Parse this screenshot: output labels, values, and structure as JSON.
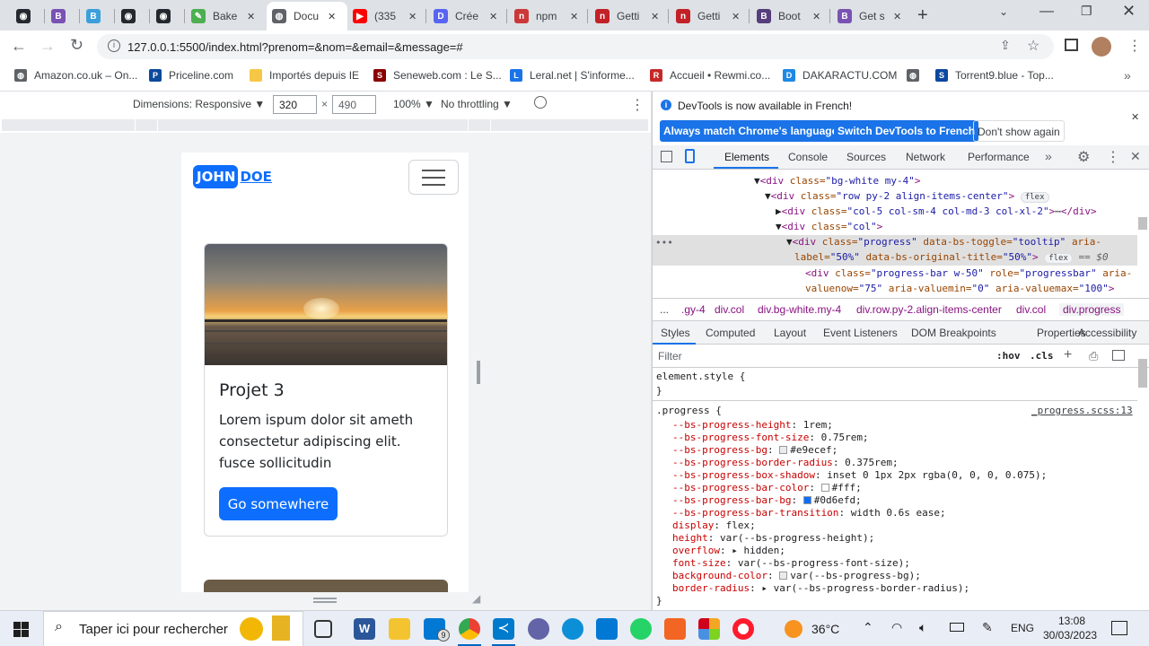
{
  "tabs": [
    {
      "title": "",
      "color": "#24292f",
      "glyph": "◉"
    },
    {
      "title": "",
      "color": "#7952b3",
      "glyph": "B"
    },
    {
      "title": "",
      "color": "#3c9fd9",
      "glyph": "B"
    },
    {
      "title": "",
      "color": "#24292f",
      "glyph": "◉"
    },
    {
      "title": "",
      "color": "#24292f",
      "glyph": "◉"
    },
    {
      "title": "Bake",
      "color": "#4caf50",
      "glyph": "✎"
    },
    {
      "title": "Docu",
      "color": "#5f6368",
      "glyph": "◍"
    },
    {
      "title": "(335",
      "color": "#ff0000",
      "glyph": "▶"
    },
    {
      "title": "Crée",
      "color": "#5865f2",
      "glyph": "D"
    },
    {
      "title": "npm",
      "color": "#cb3837",
      "glyph": "n"
    },
    {
      "title": "Getti",
      "color": "#c12127",
      "glyph": "n"
    },
    {
      "title": "Getti",
      "color": "#c12127",
      "glyph": "n"
    },
    {
      "title": "Boot",
      "color": "#563d7c",
      "glyph": "B"
    },
    {
      "title": "Get s",
      "color": "#7952b3",
      "glyph": "B"
    }
  ],
  "toolbar": {
    "url": "127.0.0.1:5500/index.html?prenom=&nom=&email=&message=#"
  },
  "bookmarks": [
    {
      "label": "Amazon.co.uk – On...",
      "color": "#5f6368",
      "glyph": "◍"
    },
    {
      "label": "Priceline.com",
      "color": "#0c4a9c",
      "glyph": "P"
    },
    {
      "label": "Importés depuis IE",
      "color": "#f6c744",
      "glyph": ""
    },
    {
      "label": "Seneweb.com : Le S...",
      "color": "#8b0000",
      "glyph": "S"
    },
    {
      "label": "Leral.net | S'informe...",
      "color": "#1a73e8",
      "glyph": "L"
    },
    {
      "label": "Accueil • Rewmi.co...",
      "color": "#c62828",
      "glyph": "R"
    },
    {
      "label": "DAKARACTU.COM",
      "color": "#1e88e5",
      "glyph": "D"
    },
    {
      "label": "",
      "color": "#5f6368",
      "glyph": "◍"
    },
    {
      "label": "Torrent9.blue - Top...",
      "color": "#0d47a1",
      "glyph": "S"
    }
  ],
  "devbar": {
    "dimensions": "Dimensions: Responsive ▼",
    "width": "320",
    "height": "490",
    "zoom": "100% ▼",
    "throttle": "No throttling ▼"
  },
  "site": {
    "brand_john": "JOHN",
    "brand_doe": "DOE",
    "card_title": "Projet 3",
    "card_text": "Lorem ispum dolor sit ameth consectetur adipiscing elit. fusce sollicitudin",
    "card_button": "Go somewhere"
  },
  "devtools": {
    "banner_text": "DevTools is now available in French!",
    "btn_match": "Always match Chrome's language",
    "btn_switch": "Switch DevTools to French",
    "btn_dont": "Don't show again",
    "tabs": [
      "Elements",
      "Console",
      "Sources",
      "Network",
      "Performance"
    ],
    "breadcrumbs": [
      "...",
      ".gy-4",
      "div.col",
      "div.bg-white.my-4",
      "div.row.py-2.align-items-center",
      "div.col",
      "div.progress"
    ],
    "style_tabs": [
      "Styles",
      "Computed",
      "Layout",
      "Event Listeners",
      "DOM Breakpoints",
      "Properties",
      "Accessibility"
    ],
    "filter_placeholder": "Filter",
    "hov": ":hov",
    "cls": ".cls",
    "element_style": "element.style {",
    "close_brace": "}",
    "rule_selector": ".progress {",
    "rule_source": "_progress.scss:13",
    "dom": {
      "l1_tag": "<div class=",
      "l1_val": "\"bg-white my-4\"",
      "l2_val": "\"row py-2 align-items-center\"",
      "l2_badge": "flex",
      "l3_val": "\"col-5 col-sm-4 col-md-3 col-xl-2\"",
      "l4_val": "\"col\"",
      "l5_val": "\"progress\"",
      "l5_attr1": "data-bs-toggle=",
      "l5_val2": "\"tooltip\"",
      "l5_attr2": "aria-",
      "l6_attr": "label=",
      "l6_val": "\"50%\"",
      "l6_attr2": "data-bs-original-title=",
      "l6_val2": "\"50%\"",
      "l6_badge": "flex",
      "l6_eq": "== $0",
      "l7_val": "\"progress-bar w-50\"",
      "l7_attr": "role=",
      "l7_val2": "\"progressbar\"",
      "l7_attr2": "aria-",
      "l8_attr": "valuenow=",
      "l8_val": "\"75\"",
      "l8_attr2": "aria-valuemin=",
      "l8_val2": "\"0\"",
      "l8_attr3": "aria-valuemax=",
      "l8_val3": "\"100\""
    },
    "css_props": [
      {
        "name": "--bs-progress-height",
        "value": "1rem;"
      },
      {
        "name": "--bs-progress-font-size",
        "value": "0.75rem;"
      },
      {
        "name": "--bs-progress-bg",
        "value": "#e9ecef;",
        "swatch": "#e9ecef"
      },
      {
        "name": "--bs-progress-border-radius",
        "value": "0.375rem;"
      },
      {
        "name": "--bs-progress-box-shadow",
        "value": "inset 0 1px 2px rgba(0, 0, 0, 0.075);"
      },
      {
        "name": "--bs-progress-bar-color",
        "value": "#fff;",
        "swatch": "#ffffff"
      },
      {
        "name": "--bs-progress-bar-bg",
        "value": "#0d6efd;",
        "swatch": "#0d6efd"
      },
      {
        "name": "--bs-progress-bar-transition",
        "value": "width 0.6s ease;"
      },
      {
        "name": "display",
        "value": "flex;"
      },
      {
        "name": "height",
        "value": "var(--bs-progress-height);"
      },
      {
        "name": "overflow",
        "value": "▸ hidden;"
      },
      {
        "name": "font-size",
        "value": "var(--bs-progress-font-size);"
      },
      {
        "name": "background-color",
        "value": "var(--bs-progress-bg);",
        "swatch": "#e9ecef"
      },
      {
        "name": "border-radius",
        "value": "▸ var(--bs-progress-border-radius);"
      }
    ]
  },
  "taskbar": {
    "search": "Taper ici pour rechercher",
    "temp": "36°C",
    "lang": "ENG",
    "time": "13:08",
    "date": "30/03/2023",
    "mail_badge": "9"
  },
  "colors": {
    "primary": "#0d6efd",
    "devtools_blue": "#1a73e8"
  }
}
